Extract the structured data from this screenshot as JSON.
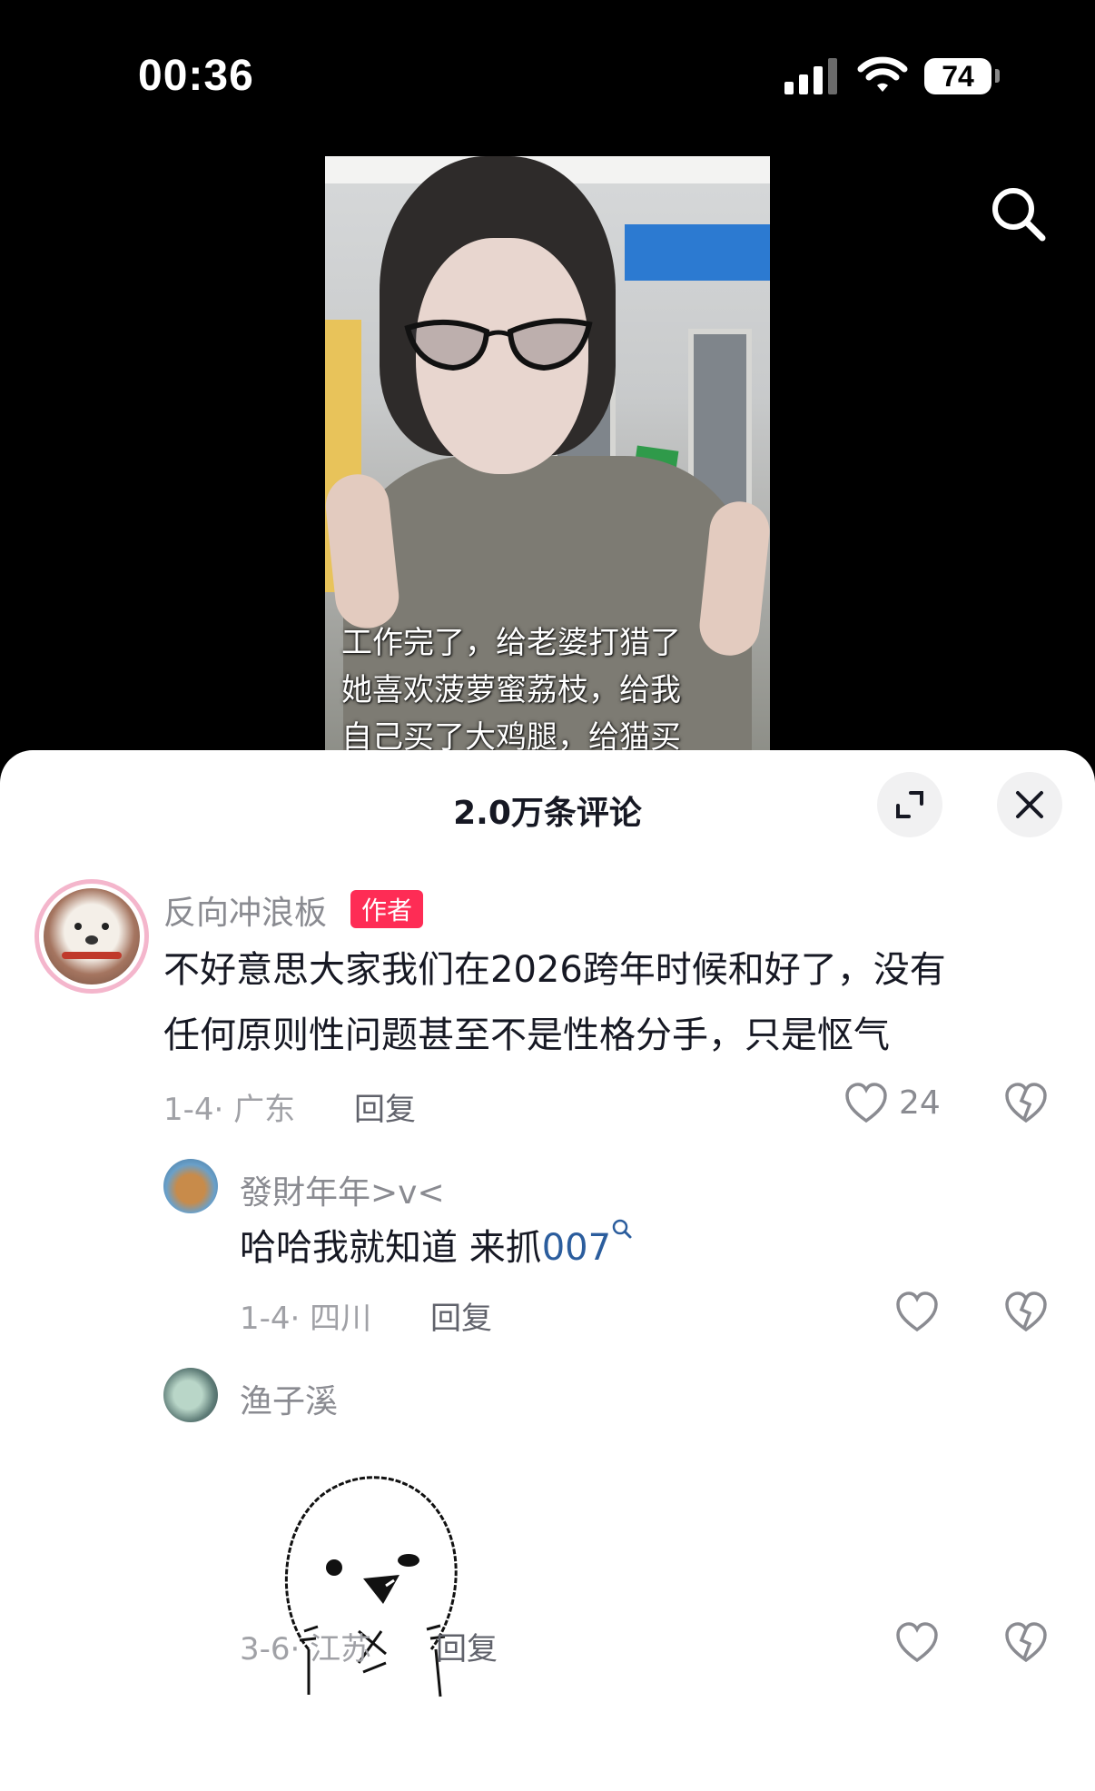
{
  "status_bar": {
    "time": "00:36",
    "battery": "74"
  },
  "video": {
    "caption_lines": [
      "工作完了，给老婆打猎了",
      "她喜欢菠萝蜜荔枝，给我",
      "自己买了大鸡腿，给猫买"
    ]
  },
  "comments_panel": {
    "title": "2.0万条评论",
    "comments": [
      {
        "username": "反向冲浪板",
        "tag": "作者",
        "text_lines": [
          "不好意思大家我们在2026跨年时候和好了，没有",
          "任何原则性问题甚至不是性格分手，只是怄气"
        ],
        "meta": "1-4· 广东",
        "reply": "回复",
        "likes": "24"
      },
      {
        "username": "發財年年>v<",
        "text": "哈哈我就知道 来抓",
        "link": "007",
        "meta": "1-4· 四川",
        "reply": "回复"
      },
      {
        "username": "渔子溪",
        "meta": "3-6· 江苏",
        "reply": "回复"
      }
    ]
  },
  "colors": {
    "accent": "#fe2c55",
    "link": "#2b5d9d"
  },
  "icons": [
    "signal-icon",
    "wifi-icon",
    "search-icon",
    "expand-icon",
    "close-icon",
    "heart-icon",
    "dislike-icon",
    "magnifier-icon"
  ]
}
